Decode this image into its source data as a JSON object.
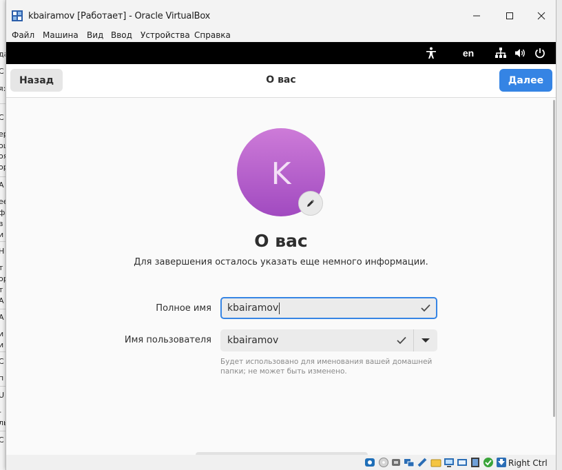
{
  "window": {
    "title": "kbairamov [Работает] - Oracle VirtualBox",
    "minimize_icon": "minimize-icon",
    "maximize_icon": "maximize-icon",
    "close_icon": "close-icon"
  },
  "menubar": {
    "items": [
      "Файл",
      "Машина",
      "Вид",
      "Ввод",
      "Устройства",
      "Справка"
    ]
  },
  "guest_topbar": {
    "accessibility_icon": "accessibility-icon",
    "language": "en",
    "network_icon": "network-icon",
    "volume_icon": "volume-icon",
    "power_icon": "power-icon"
  },
  "header": {
    "back_label": "Назад",
    "title": "О вас",
    "next_label": "Далее",
    "accent_color": "#3584e4"
  },
  "avatar": {
    "letter": "K",
    "edit_icon": "pencil-icon",
    "color": "#b45fcc"
  },
  "main": {
    "title": "О вас",
    "subtitle": "Для завершения осталось указать еще немного информации."
  },
  "form": {
    "fullname_label": "Полное имя",
    "fullname_value": "kbairamov",
    "username_label": "Имя пользователя",
    "username_value": "kbairamov",
    "hint_line1": "Будет использовано для именования вашей домашней",
    "hint_line2": "папки; не может быть изменено."
  },
  "statusbar": {
    "host_key": "Right Ctrl"
  }
}
